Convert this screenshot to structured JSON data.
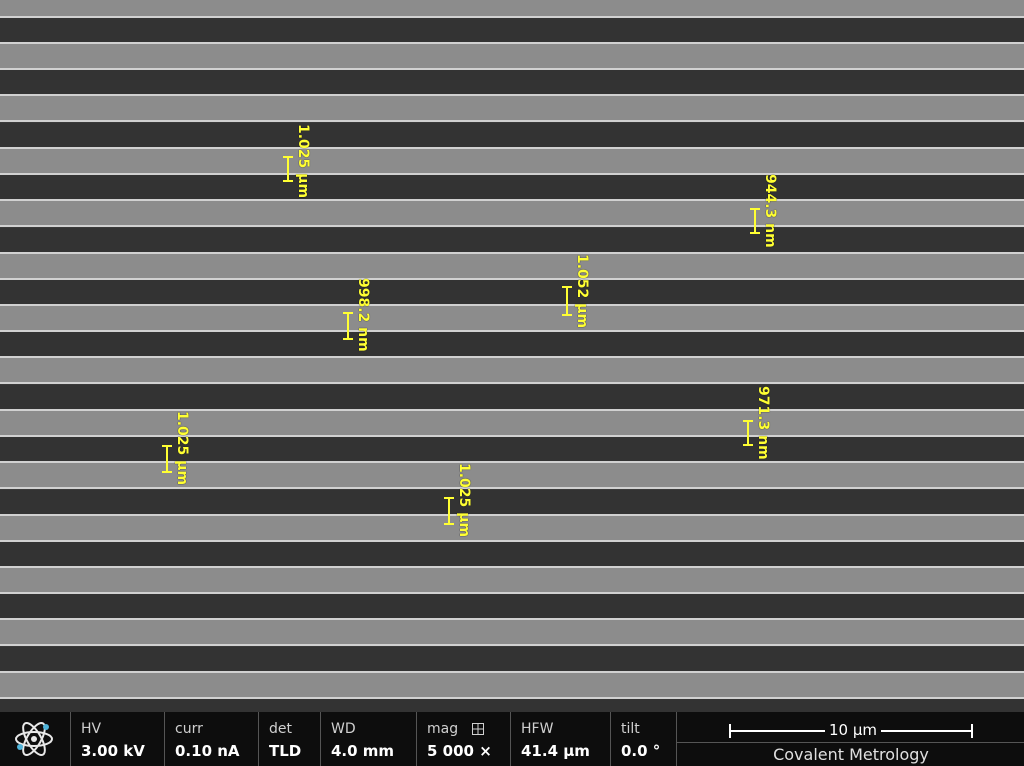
{
  "measurements": [
    {
      "label": "1.025 µm"
    },
    {
      "label": "944.3 nm"
    },
    {
      "label": "1.052 µm"
    },
    {
      "label": "998.2 nm"
    },
    {
      "label": "971.3 nm"
    },
    {
      "label": "1.025 µm"
    },
    {
      "label": "1.025 µm"
    }
  ],
  "databar": {
    "fields": [
      {
        "label": "HV",
        "value": "3.00 kV"
      },
      {
        "label": "curr",
        "value": "0.10 nA"
      },
      {
        "label": "det",
        "value": "TLD"
      },
      {
        "label": "WD",
        "value": "4.0 mm"
      },
      {
        "label": "mag",
        "value": "5 000 ×"
      },
      {
        "label": "HFW",
        "value": "41.4 µm"
      },
      {
        "label": "tilt",
        "value": "0.0 °"
      }
    ],
    "mag_icon": "grid-icon",
    "logo_icon": "atom-icon",
    "scale_bar": "10 µm",
    "organization": "Covalent Metrology"
  },
  "colors": {
    "annotation": "#ffff33",
    "dark_stripe": "#333333",
    "light_stripe": "#8c8c8c",
    "databar_bg": "#0d0d0d"
  }
}
